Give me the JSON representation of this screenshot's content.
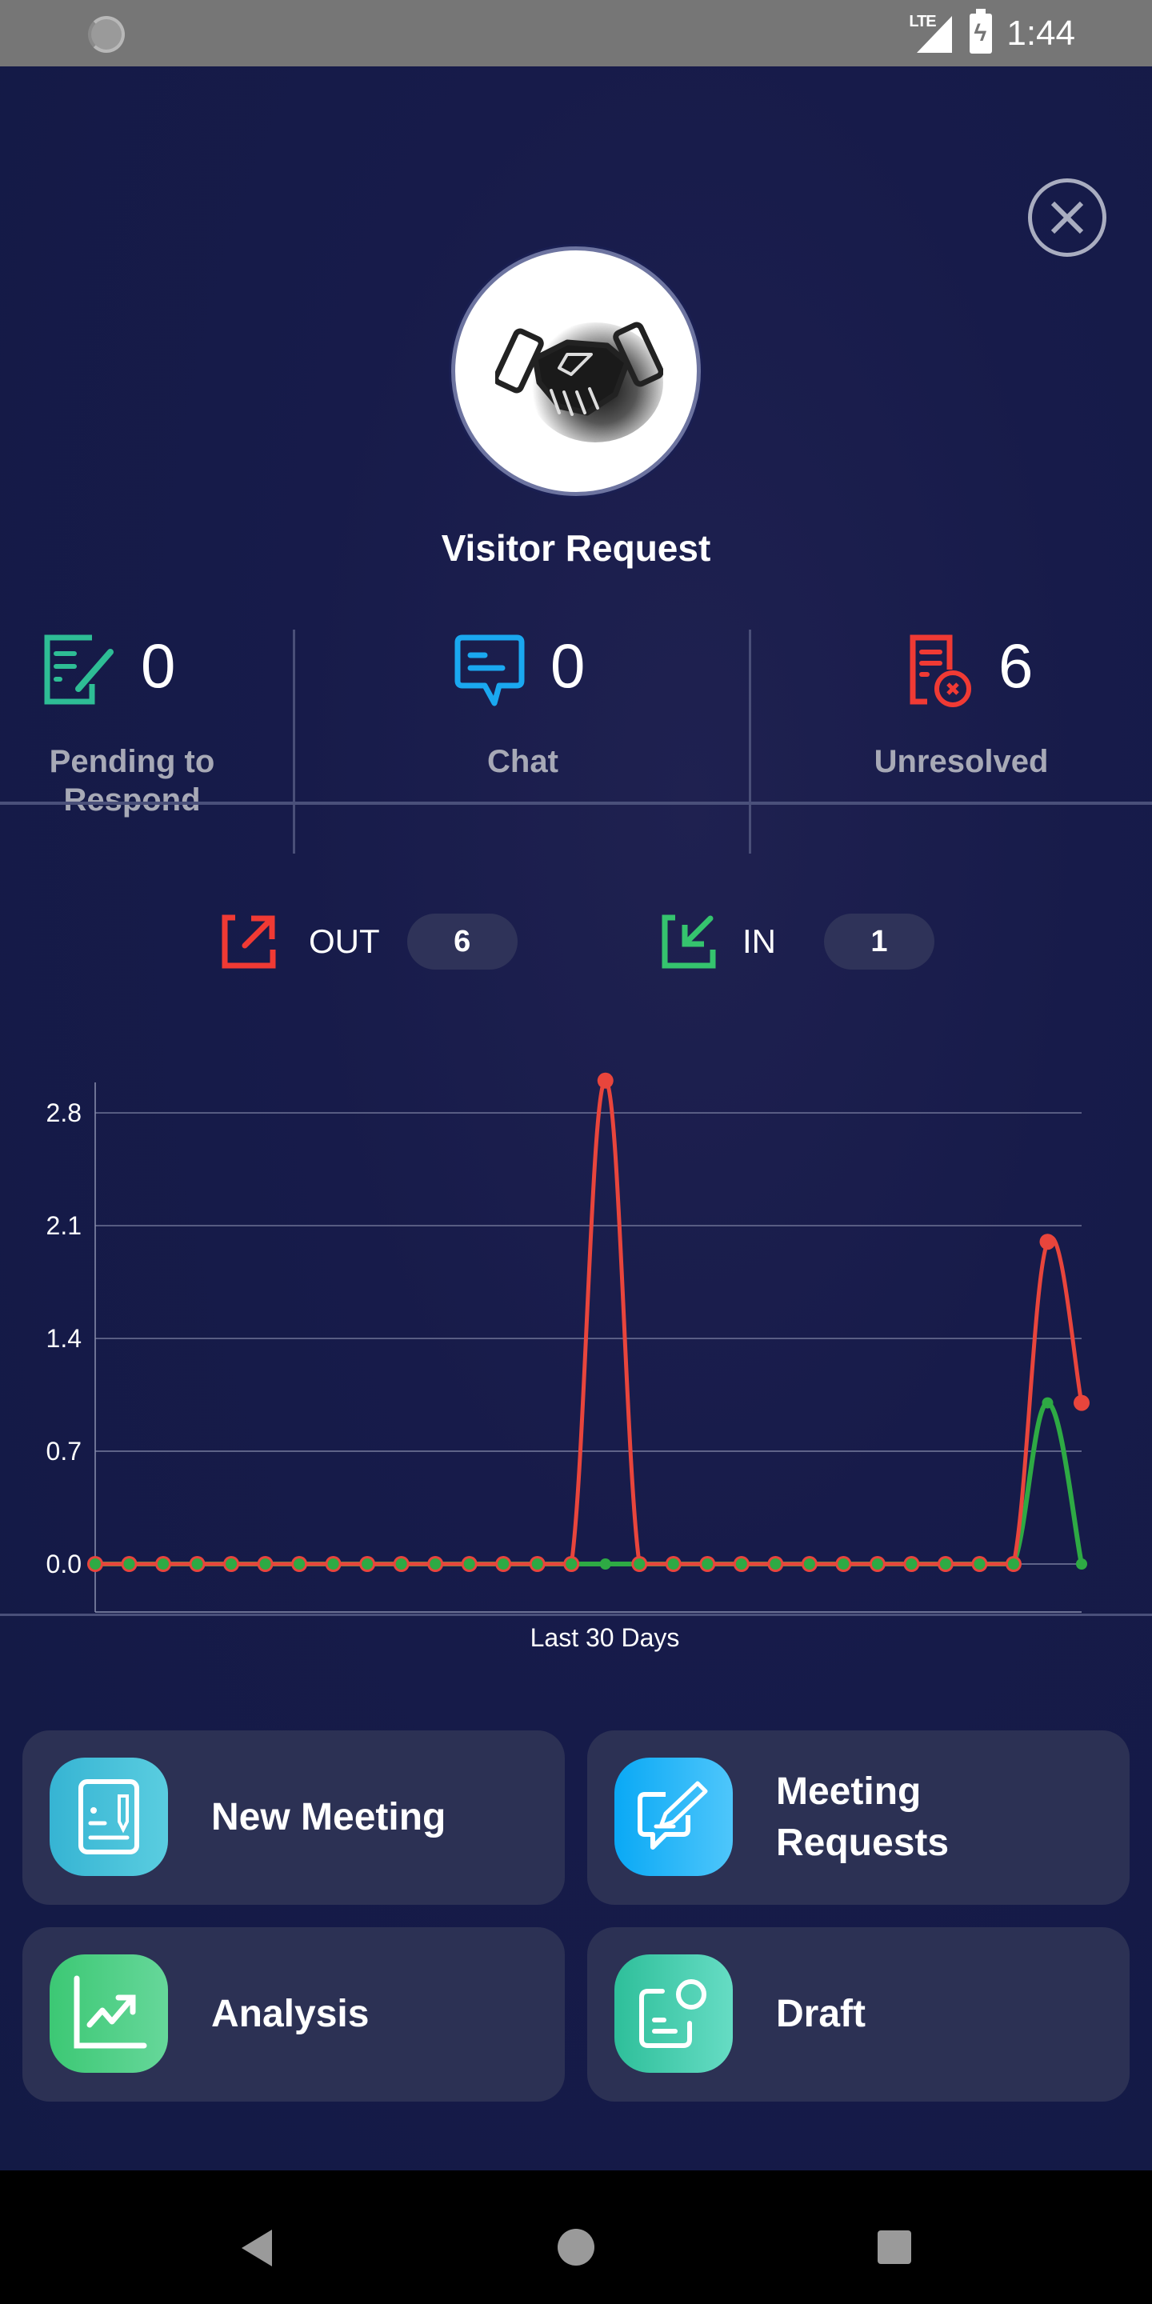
{
  "status_bar": {
    "network": "LTE",
    "time": "1:44",
    "icons": [
      "sync-icon",
      "lte-signal-icon",
      "battery-charging-icon"
    ]
  },
  "header": {
    "title": "Visitor Request",
    "avatar_icon": "handshake-icon",
    "close_icon": "close-circle-icon"
  },
  "stats": [
    {
      "icon": "form-pen-icon",
      "value": "0",
      "label": "Pending to Respond",
      "color": "#2ebd95"
    },
    {
      "icon": "chat-bubble-icon",
      "value": "0",
      "label": "Chat",
      "color": "#1aa8f0"
    },
    {
      "icon": "document-error-icon",
      "value": "6",
      "label": "Unresolved",
      "color": "#f03a34"
    }
  ],
  "inout": {
    "out": {
      "label": "OUT",
      "count": "6",
      "icon": "arrow-out-icon",
      "color": "#f03a34"
    },
    "in": {
      "label": "IN",
      "count": "1",
      "icon": "arrow-in-icon",
      "color": "#35c46e"
    }
  },
  "chart_data": {
    "type": "line",
    "title": "",
    "xlabel": "Last 30 Days",
    "ylabel": "",
    "ylim": [
      0.0,
      2.8
    ],
    "yticks": [
      "0.0",
      "0.7",
      "1.4",
      "2.1",
      "2.8"
    ],
    "grid": true,
    "smooth": true,
    "x": [
      1,
      2,
      3,
      4,
      5,
      6,
      7,
      8,
      9,
      10,
      11,
      12,
      13,
      14,
      15,
      16,
      17,
      18,
      19,
      20,
      21,
      22,
      23,
      24,
      25,
      26,
      27,
      28,
      29,
      30
    ],
    "series": [
      {
        "name": "OUT",
        "color": "#e8453c",
        "values": [
          0,
          0,
          0,
          0,
          0,
          0,
          0,
          0,
          0,
          0,
          0,
          0,
          0,
          0,
          0,
          3,
          0,
          0,
          0,
          0,
          0,
          0,
          0,
          0,
          0,
          0,
          0,
          0,
          2,
          1
        ]
      },
      {
        "name": "IN",
        "color": "#2eaa44",
        "values": [
          0,
          0,
          0,
          0,
          0,
          0,
          0,
          0,
          0,
          0,
          0,
          0,
          0,
          0,
          0,
          0,
          0,
          0,
          0,
          0,
          0,
          0,
          0,
          0,
          0,
          0,
          0,
          0,
          1,
          0
        ]
      }
    ]
  },
  "tiles": [
    {
      "label": "New Meeting",
      "icon": "new-meeting-icon",
      "colors": [
        "#36b4d3",
        "#5acde0"
      ]
    },
    {
      "label": "Meeting Requests",
      "icon": "meeting-requests-icon",
      "colors": [
        "#0aa9f5",
        "#4ec6fb"
      ]
    },
    {
      "label": "Analysis",
      "icon": "analysis-chart-icon",
      "colors": [
        "#3cc874",
        "#66d79a"
      ]
    },
    {
      "label": "Draft",
      "icon": "draft-icon",
      "colors": [
        "#2ebf9a",
        "#66dcc4"
      ]
    }
  ],
  "nav_bar": {
    "buttons": [
      "back",
      "home",
      "recents"
    ]
  }
}
